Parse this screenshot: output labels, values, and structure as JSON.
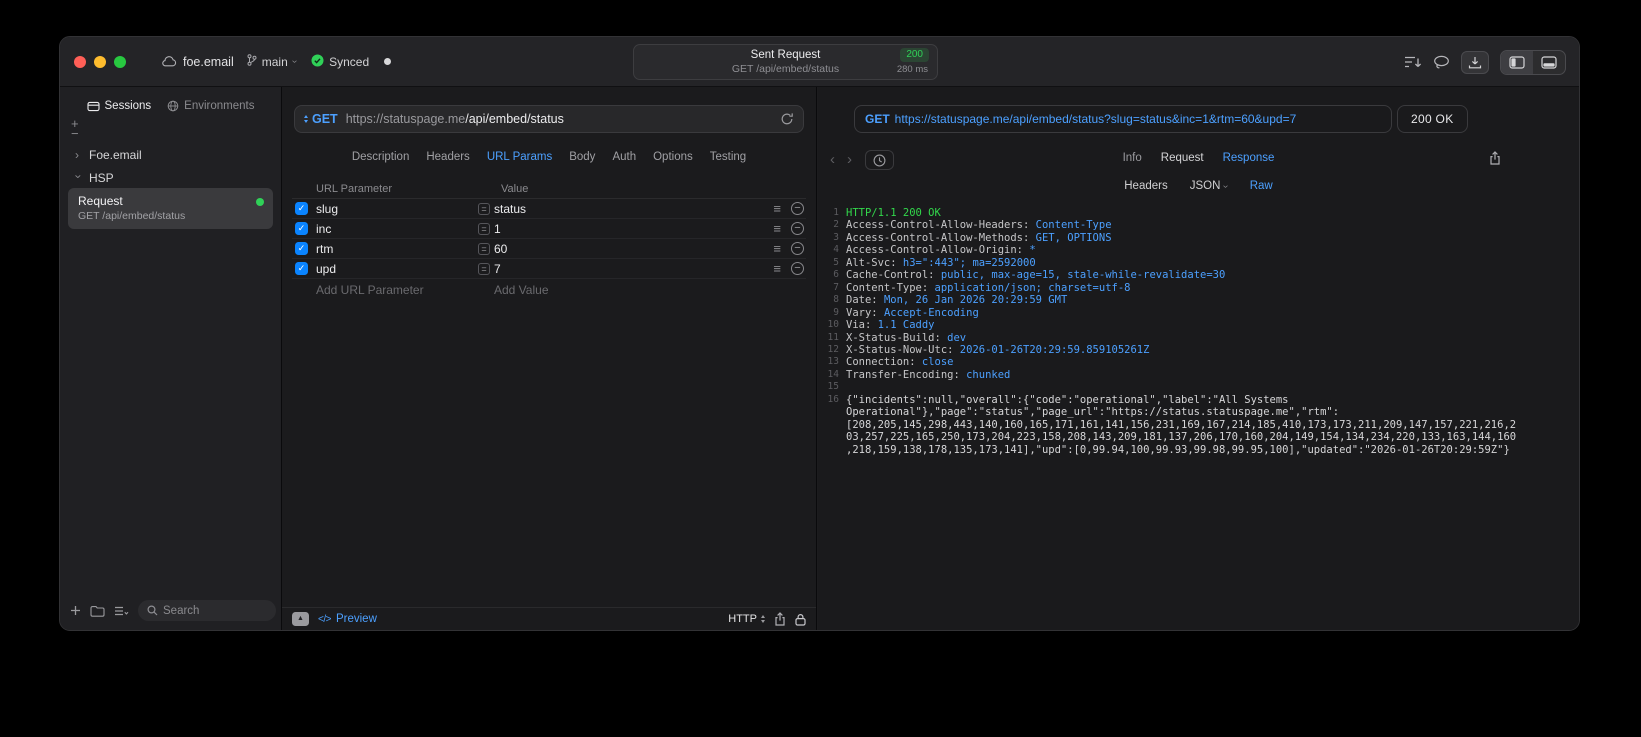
{
  "colors": {
    "accent_blue": "#4ca0ff",
    "success_green": "#30d158",
    "checkbox_blue": "#0a84ff"
  },
  "titlebar": {
    "project": "foe.email",
    "branch": "main",
    "sync_status": "Synced",
    "request": {
      "title": "Sent Request",
      "status_code": "200",
      "subtitle": "GET /api/embed/status",
      "duration": "280 ms"
    }
  },
  "sidebar": {
    "tabs": [
      {
        "label": "Sessions",
        "active": true
      },
      {
        "label": "Environments",
        "active": false
      }
    ],
    "tree": [
      {
        "label": "Foe.email",
        "state": "collapsed"
      },
      {
        "label": "HSP",
        "state": "expanded"
      }
    ],
    "request_item": {
      "title": "Request",
      "subtitle": "GET /api/embed/status",
      "status_dot_color": "#30d158"
    },
    "search": {
      "placeholder": "Search"
    }
  },
  "request_panel": {
    "method": "GET",
    "url_host": "https://statuspage.me",
    "url_path": "/api/embed/status",
    "tabs": [
      "Description",
      "Headers",
      "URL Params",
      "Body",
      "Auth",
      "Options",
      "Testing"
    ],
    "active_tab": "URL Params",
    "params": {
      "columns": [
        "URL Parameter",
        "Value"
      ],
      "rows": [
        {
          "name": "slug",
          "value": "status",
          "enabled": true
        },
        {
          "name": "inc",
          "value": "1",
          "enabled": true
        },
        {
          "name": "rtm",
          "value": "60",
          "enabled": true
        },
        {
          "name": "upd",
          "value": "7",
          "enabled": true
        }
      ],
      "add_name_placeholder": "Add URL Parameter",
      "add_value_placeholder": "Add Value"
    },
    "footer": {
      "preview": "Preview",
      "protocol": "HTTP"
    }
  },
  "response_panel": {
    "request_line": {
      "method": "GET",
      "url": "https://statuspage.me/api/embed/status?slug=status&inc=1&rtm=60&upd=7"
    },
    "status": "200 OK",
    "tabs": [
      "Info",
      "Request",
      "Response"
    ],
    "active_tab": "Response",
    "subtabs": [
      "Headers",
      "JSON",
      "Raw"
    ],
    "active_subtab": "Raw",
    "dropdown_subtab": "JSON",
    "lines": [
      {
        "n": 1,
        "type": "status",
        "text": "HTTP/1.1 200 OK"
      },
      {
        "n": 2,
        "type": "header",
        "name": "Access-Control-Allow-Headers",
        "value": "Content-Type"
      },
      {
        "n": 3,
        "type": "header",
        "name": "Access-Control-Allow-Methods",
        "value": "GET, OPTIONS"
      },
      {
        "n": 4,
        "type": "header",
        "name": "Access-Control-Allow-Origin",
        "value": "*"
      },
      {
        "n": 5,
        "type": "header",
        "name": "Alt-Svc",
        "value": "h3=\":443\"; ma=2592000"
      },
      {
        "n": 6,
        "type": "header",
        "name": "Cache-Control",
        "value": "public, max-age=15, stale-while-revalidate=30"
      },
      {
        "n": 7,
        "type": "header",
        "name": "Content-Type",
        "value": "application/json; charset=utf-8"
      },
      {
        "n": 8,
        "type": "header",
        "name": "Date",
        "value": "Mon, 26 Jan 2026 20:29:59 GMT"
      },
      {
        "n": 9,
        "type": "header",
        "name": "Vary",
        "value": "Accept-Encoding"
      },
      {
        "n": 10,
        "type": "header",
        "name": "Via",
        "value": "1.1 Caddy"
      },
      {
        "n": 11,
        "type": "header",
        "name": "X-Status-Build",
        "value": "dev"
      },
      {
        "n": 12,
        "type": "header",
        "name": "X-Status-Now-Utc",
        "value": "2026-01-26T20:29:59.859105261Z"
      },
      {
        "n": 13,
        "type": "header",
        "name": "Connection",
        "value": "close"
      },
      {
        "n": 14,
        "type": "header",
        "name": "Transfer-Encoding",
        "value": "chunked"
      },
      {
        "n": 15,
        "type": "blank"
      },
      {
        "n": 16,
        "type": "body",
        "text": "{\"incidents\":null,\"overall\":{\"code\":\"operational\",\"label\":\"All Systems Operational\"},\"page\":\"status\",\"page_url\":\"https://status.statuspage.me\",\"rtm\":[208,205,145,298,443,140,160,165,171,161,141,156,231,169,167,214,185,410,173,173,211,209,147,157,221,216,203,257,225,165,250,173,204,223,158,208,143,209,181,137,206,170,160,204,149,154,134,234,220,133,163,144,160,218,159,138,178,135,173,141],\"upd\":[0,99.94,100,99.93,99.98,99.95,100],\"updated\":\"2026-01-26T20:29:59Z\"}"
      }
    ]
  }
}
